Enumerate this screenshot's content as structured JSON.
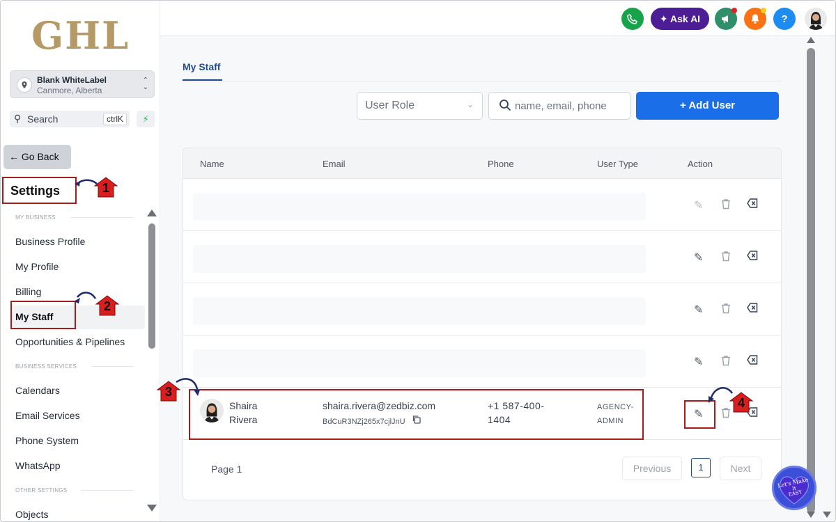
{
  "logo_text": "GHL",
  "account": {
    "name": "Blank WhiteLabel",
    "location": "Canmore, Alberta"
  },
  "sidebar_search": {
    "label": "Search",
    "shortcut": "ctrlK"
  },
  "go_back_label": "Go Back",
  "settings_title": "Settings",
  "sections": {
    "my_business": "MY BUSINESS",
    "business_services": "BUSINESS SERVICES",
    "other_settings": "OTHER SETTINGS"
  },
  "nav": {
    "business_profile": "Business Profile",
    "my_profile": "My Profile",
    "billing": "Billing",
    "my_staff": "My Staff",
    "opportunities": "Opportunities & Pipelines",
    "calendars": "Calendars",
    "email_services": "Email Services",
    "phone_system": "Phone System",
    "whatsapp": "WhatsApp",
    "objects": "Objects"
  },
  "topbar": {
    "ask_ai_label": "Ask AI",
    "help_label": "?"
  },
  "tab_label": "My Staff",
  "filters": {
    "user_role_placeholder": "User Role",
    "search_placeholder": "name, email, phone",
    "add_user_label": "+ Add User"
  },
  "table": {
    "headers": {
      "name": "Name",
      "email": "Email",
      "phone": "Phone",
      "user_type": "User Type",
      "action": "Action"
    },
    "user": {
      "first_name": "Shaira",
      "last_name": "Rivera",
      "email": "shaira.rivera@zedbiz.com",
      "user_id": "BdCuR3NZj265x7cjlJnU",
      "phone_line1": "+1 587-400-",
      "phone_line2": "1404",
      "type_line1": "AGENCY-",
      "type_line2": "ADMIN"
    }
  },
  "pagination": {
    "page_label": "Page 1",
    "previous": "Previous",
    "current": "1",
    "next": "Next"
  },
  "annotations": [
    "1",
    "2",
    "3",
    "4"
  ],
  "watermark_text": [
    "Let's Make",
    "It",
    "EASY"
  ],
  "colors": {
    "primary": "#1a6ee8",
    "annotation": "#a51c1c",
    "ask_ai": "#4c1d95",
    "phone": "#16a34a",
    "bell": "#f97316",
    "help": "#1d8cf0"
  }
}
